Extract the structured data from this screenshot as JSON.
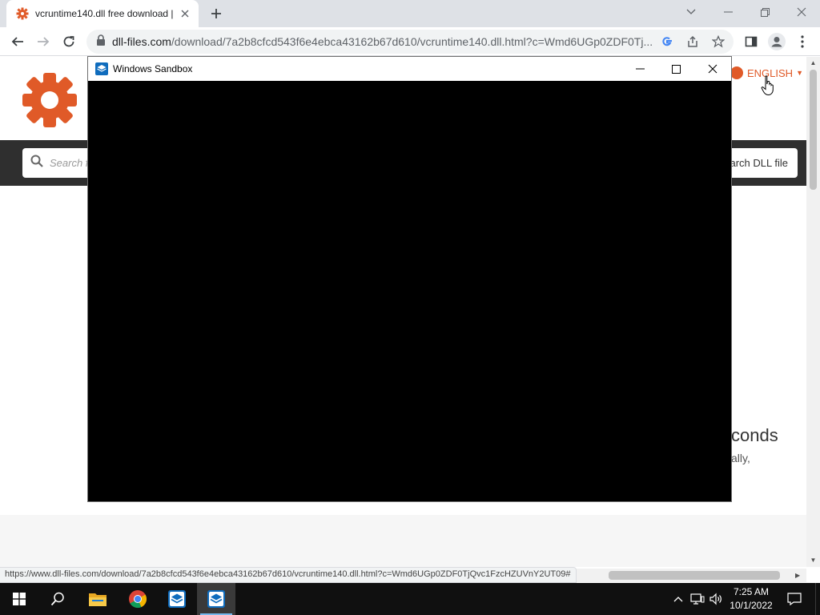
{
  "browser": {
    "tab": {
      "title": "vcruntime140.dll free download |"
    },
    "address": {
      "url_host": "dll-files.com",
      "url_path": "/download/7a2b8cfcd543f6e4ebca43162b67d610/vcruntime140.dll.html?c=Wmd6UGp0ZDF0Tj..."
    },
    "status_url": "https://www.dll-files.com/download/7a2b8cfcd543f6e4ebca43162b67d610/vcruntime140.dll.html?c=Wmd6UGp0ZDF0TjQvc1FzcHZUVnY2UT09#"
  },
  "site": {
    "accent_color": "#e05a28",
    "language_label": "ENGLISH",
    "search_placeholder": "Search fo",
    "search_button_label": "arch DLL file",
    "peek_heading": "conds",
    "peek_subtext": "ally,"
  },
  "sandbox_window": {
    "title": "Windows Sandbox"
  },
  "taskbar": {
    "time": "7:25 AM",
    "date": "10/1/2022",
    "pinned": [
      "windows-start-icon",
      "search-icon",
      "file-explorer-icon",
      "chrome-icon",
      "windows-sandbox-icon",
      "windows-sandbox-icon"
    ]
  }
}
